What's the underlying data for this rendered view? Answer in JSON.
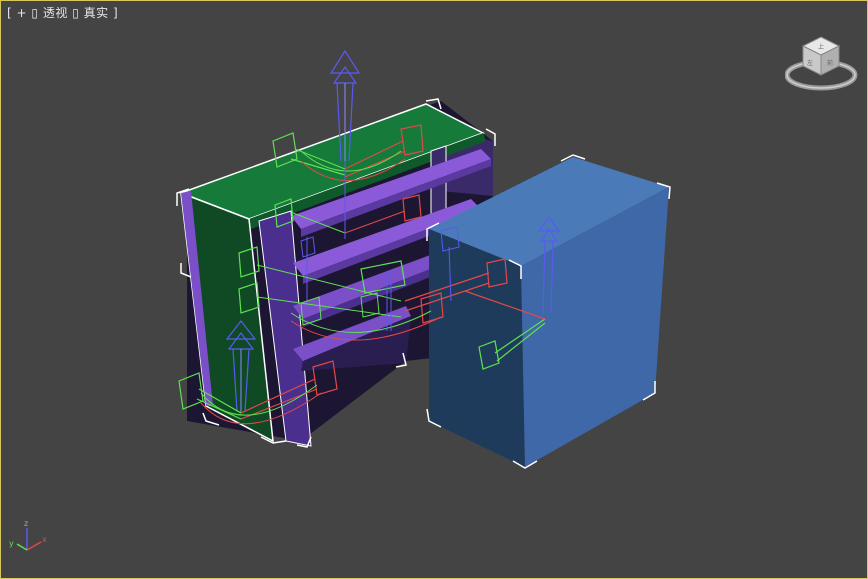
{
  "viewport": {
    "label": {
      "open_bracket": "[",
      "plus": "+",
      "view_mode": "透视",
      "shading_mode": "真实",
      "close_bracket": "]",
      "marker": "▯"
    },
    "border_color": "#d8c85a",
    "background_color": "#444444"
  },
  "scene": {
    "objects": [
      {
        "name": "shelf-top-board",
        "color": "#157a3a"
      },
      {
        "name": "shelf-left-side-panel",
        "color": "#0f4a25"
      },
      {
        "name": "shelf-boards",
        "color": "#7a4fc8"
      },
      {
        "name": "box-cabinet",
        "color": "#4a7ab8"
      }
    ],
    "gizmo_colors": {
      "x": "#e34848",
      "y": "#5fe052",
      "z": "#5a5af0"
    }
  },
  "viewcube": {
    "icon": "viewcube-icon",
    "face_labels": {
      "top": "上",
      "front": "前",
      "left": "左"
    }
  },
  "axis_tripod": {
    "x_label": "x",
    "y_label": "y",
    "z_label": "z"
  }
}
